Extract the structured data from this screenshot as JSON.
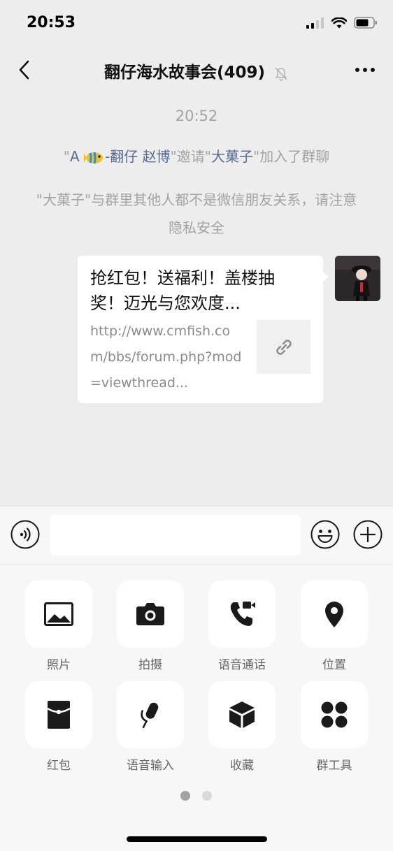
{
  "status": {
    "time": "20:53"
  },
  "header": {
    "title": "翻仔海水故事会(409)"
  },
  "chat": {
    "timestamp": "20:52",
    "system_invite": {
      "q1": "\"",
      "inviter": "A",
      "inviter_suffix": "-翻仔 赵博",
      "q2": "\"邀请\"",
      "invitee": "大菓子",
      "tail": "\"加入了群聊"
    },
    "system_notice": "\"大菓子\"与群里其他人都不是微信朋友关系，请注意隐私安全",
    "link_card": {
      "title": "抢红包！送福利！盖楼抽奖！迈光与您欢度...",
      "url": "http://www.cmfish.com/bbs/forum.php?mod=viewthread..."
    }
  },
  "input": {
    "value": "",
    "placeholder": ""
  },
  "panel": {
    "tiles": [
      {
        "label": "照片",
        "icon": "photo-icon"
      },
      {
        "label": "拍摄",
        "icon": "camera-icon"
      },
      {
        "label": "语音通话",
        "icon": "voice-call-icon"
      },
      {
        "label": "位置",
        "icon": "location-icon"
      },
      {
        "label": "红包",
        "icon": "red-packet-icon"
      },
      {
        "label": "语音输入",
        "icon": "voice-input-icon"
      },
      {
        "label": "收藏",
        "icon": "favorites-icon"
      },
      {
        "label": "群工具",
        "icon": "group-tools-icon"
      }
    ],
    "page_count": 2,
    "current_page": 1
  },
  "colors": {
    "background": "#ededed",
    "link_name": "#576b95",
    "system_text": "#a3a3a3"
  }
}
